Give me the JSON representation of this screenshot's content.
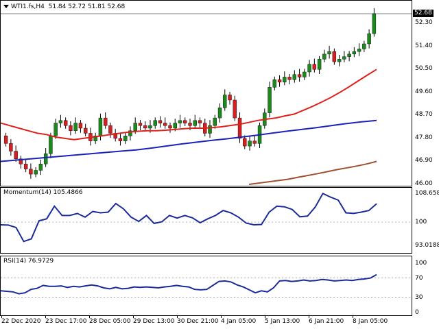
{
  "header": {
    "symbol": "WTI1.fs,H4",
    "ohlc": "51.84 52.72 51.81 52.68"
  },
  "colors": {
    "bull": "#1a8a1a",
    "bear": "#d42020",
    "ma_fast": "#e0201a",
    "ma_mid": "#1a22b8",
    "ma_slow": "#a05030",
    "indicator": "#1a2a9a",
    "grid": "#888888"
  },
  "price_scale": {
    "labels": [
      "52.30",
      "51.40",
      "50.50",
      "49.60",
      "48.70",
      "47.80",
      "46.90",
      "46.00"
    ],
    "current": "52.68"
  },
  "momentum": {
    "title": "Momentum(14) 105.4866",
    "scale_labels": [
      "108.6585",
      "100",
      "93.0188"
    ]
  },
  "rsi": {
    "title": "RSI(14) 76.9729",
    "scale_labels": [
      "100",
      "70",
      "30",
      "0"
    ]
  },
  "x_axis": {
    "labels": [
      "22 Dec 2020",
      "23 Dec 17:00",
      "28 Dec 05:00",
      "29 Dec 13:00",
      "30 Dec 21:00",
      "4 Jan 05:00",
      "5 Jan 13:00",
      "6 Jan 21:00",
      "8 Jan 05:00"
    ]
  },
  "chart_data": {
    "type": "candlestick",
    "instrument": "WTI1.fs",
    "timeframe": "H4",
    "ylim": [
      46.0,
      52.68
    ],
    "close_series": [
      47.6,
      47.3,
      47.0,
      46.8,
      46.6,
      46.4,
      46.55,
      46.8,
      47.2,
      47.9,
      48.4,
      48.5,
      48.3,
      48.1,
      48.4,
      48.2,
      48.0,
      47.7,
      47.9,
      48.6,
      48.3,
      48.0,
      47.8,
      47.7,
      47.9,
      48.1,
      48.4,
      48.3,
      48.2,
      48.3,
      48.5,
      48.4,
      48.3,
      48.2,
      48.4,
      48.5,
      48.4,
      48.3,
      48.5,
      48.4,
      48.0,
      48.3,
      48.6,
      49.0,
      49.5,
      49.3,
      48.6,
      47.8,
      47.5,
      47.7,
      47.6,
      48.3,
      48.8,
      49.8,
      50.1,
      50.0,
      50.2,
      50.1,
      50.3,
      50.2,
      50.4,
      50.7,
      50.5,
      50.9,
      51.1,
      51.2,
      50.8,
      50.9,
      51.0,
      51.1,
      51.2,
      51.3,
      51.5,
      51.9,
      52.68
    ],
    "series": [
      {
        "name": "MA fast",
        "values": [
          48.4,
          48.3,
          48.2,
          48.1,
          48.0,
          47.95,
          47.85,
          47.8,
          47.75,
          47.8,
          47.85,
          47.9,
          47.95,
          48.0,
          48.05,
          48.08,
          48.1,
          48.1,
          48.12,
          48.15,
          48.18,
          48.2,
          48.2,
          48.22,
          48.25,
          48.3,
          48.35,
          48.42,
          48.5,
          48.55,
          48.6,
          48.68,
          48.75,
          48.9,
          49.05,
          49.22,
          49.4,
          49.6,
          49.82,
          50.05,
          50.28,
          50.5
        ]
      },
      {
        "name": "MA mid",
        "values": [
          46.9,
          46.95,
          47.0,
          47.05,
          47.1,
          47.15,
          47.2,
          47.25,
          47.3,
          47.35,
          47.42,
          47.5,
          47.58,
          47.65,
          47.72,
          47.78,
          47.85,
          47.92,
          48.0,
          48.08,
          48.15,
          48.22,
          48.3,
          48.38,
          48.45,
          48.5
        ]
      },
      {
        "name": "MA slow",
        "values": [
          46.0,
          46.05,
          46.1,
          46.15,
          46.2,
          46.28,
          46.35,
          46.42,
          46.5,
          46.58,
          46.65,
          46.72,
          46.8,
          46.9
        ]
      }
    ]
  }
}
